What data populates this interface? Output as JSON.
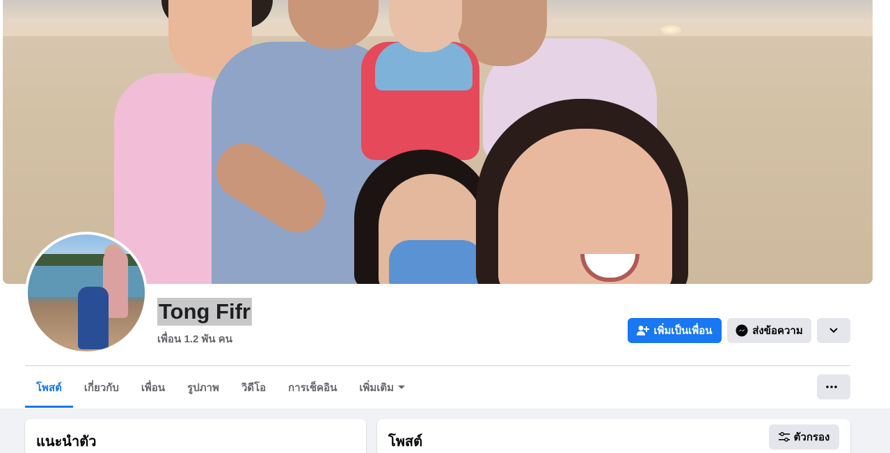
{
  "profile": {
    "name": "Tong Fifr",
    "friends_count": "เพื่อน 1.2 พัน คน"
  },
  "actions": {
    "add_friend_label": "เพิ่มเป็นเพื่อน",
    "message_label": "ส่งข้อความ"
  },
  "tabs": [
    {
      "label": "โพสต์",
      "active": true
    },
    {
      "label": "เกี่ยวกับ"
    },
    {
      "label": "เพื่อน"
    },
    {
      "label": "รูปภาพ"
    },
    {
      "label": "วิดีโอ"
    },
    {
      "label": "การเช็คอิน"
    },
    {
      "label": "เพิ่มเติม"
    }
  ],
  "intro_card": {
    "title": "แนะนำตัว"
  },
  "posts_card": {
    "title": "โพสต์",
    "filter_label": "ตัวกรอง"
  },
  "colors": {
    "primary": "#1877f2",
    "secondary_button": "#e4e6eb",
    "page_bg": "#f0f2f5"
  }
}
